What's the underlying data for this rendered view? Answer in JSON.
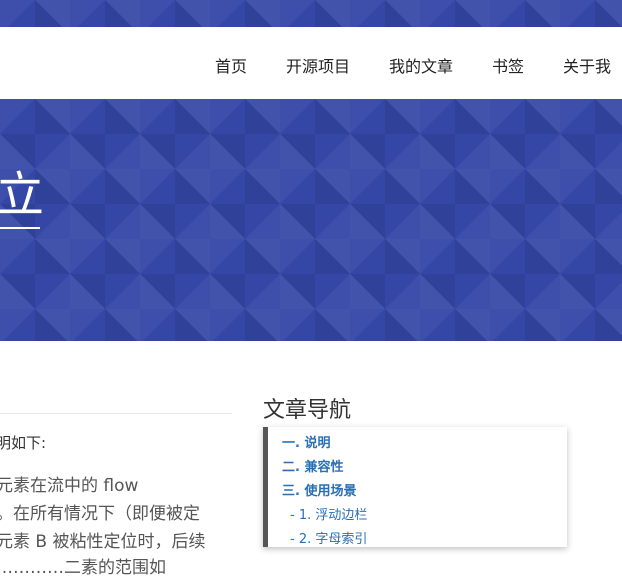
{
  "navbar": {
    "items": [
      {
        "label": "首页"
      },
      {
        "label": "开源项目"
      },
      {
        "label": "我的文章"
      },
      {
        "label": "书签"
      },
      {
        "label": "关于我"
      }
    ]
  },
  "hero": {
    "title": "立"
  },
  "article": {
    "p1": "明如下:",
    "line1": "元素在流中的 flow",
    "line2": "。在所有情况下（即便被定",
    "line3": "元素 B 被粘性定位时，后续",
    "line4": "…………二素的范围如"
  },
  "toc": {
    "heading": "文章导航",
    "items": [
      {
        "label": "一. 说明",
        "level": 1
      },
      {
        "label": "二. 兼容性",
        "level": 1
      },
      {
        "label": "三. 使用场景",
        "level": 1
      },
      {
        "label": "- 1. 浮动边栏",
        "level": 2
      },
      {
        "label": "- 2. 字母索引",
        "level": 2
      }
    ]
  },
  "colors": {
    "hero_bg": "#3446a6",
    "toc_link": "#2a6fb3",
    "toc_border": "#555555"
  }
}
